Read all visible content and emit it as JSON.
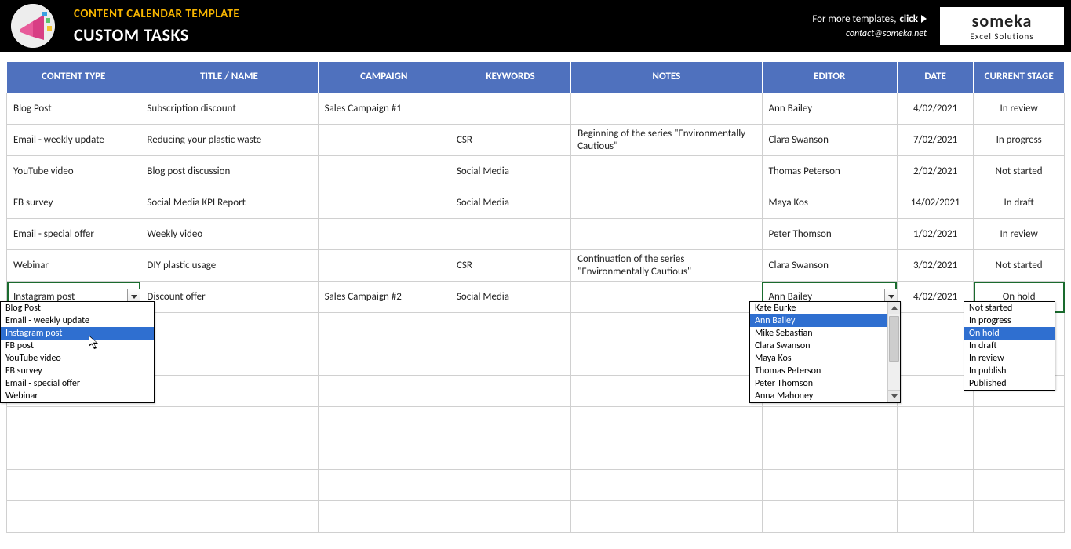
{
  "header": {
    "brand": "CONTENT CALENDAR TEMPLATE",
    "title": "CUSTOM TASKS",
    "more_text": "For more templates, ",
    "more_bold": "click",
    "contact": "contact@someka.net",
    "logo_big": "someka",
    "logo_small": "Excel Solutions"
  },
  "columns": [
    "CONTENT TYPE",
    "TITLE / NAME",
    "CAMPAIGN",
    "KEYWORDS",
    "NOTES",
    "EDITOR",
    "DATE",
    "CURRENT STAGE"
  ],
  "rows": [
    {
      "type": "Blog Post",
      "title": "Subscription discount",
      "campaign": "Sales Campaign #1",
      "keywords": "",
      "notes": "",
      "editor": "Ann Bailey",
      "date": "4/02/2021",
      "stage": "In review"
    },
    {
      "type": "Email - weekly update",
      "title": "Reducing your plastic waste",
      "campaign": "",
      "keywords": "CSR",
      "notes": "Beginning of the series \"Environmentally Cautious\"",
      "editor": "Clara Swanson",
      "date": "7/02/2021",
      "stage": "In progress"
    },
    {
      "type": "YouTube video",
      "title": "Blog post discussion",
      "campaign": "",
      "keywords": "Social Media",
      "notes": "",
      "editor": "Thomas Peterson",
      "date": "2/02/2021",
      "stage": "Not started"
    },
    {
      "type": "FB survey",
      "title": "Social Media KPI Report",
      "campaign": "",
      "keywords": "Social Media",
      "notes": "",
      "editor": "Maya Kos",
      "date": "14/02/2021",
      "stage": "In draft"
    },
    {
      "type": "Email - special offer",
      "title": "Weekly video",
      "campaign": "",
      "keywords": "",
      "notes": "",
      "editor": "Peter Thomson",
      "date": "1/02/2021",
      "stage": "In review"
    },
    {
      "type": "Webinar",
      "title": "DIY plastic usage",
      "campaign": "",
      "keywords": "CSR",
      "notes": "Continuation of the series \"Environmentally Cautious\"",
      "editor": "Clara Swanson",
      "date": "3/02/2021",
      "stage": "Not started"
    },
    {
      "type": "Instagram post",
      "title": "Discount offer",
      "campaign": "Sales Campaign #2",
      "keywords": "Social Media",
      "notes": "",
      "editor": "Ann Bailey",
      "date": "4/02/2021",
      "stage": "On hold"
    }
  ],
  "dropdowns": {
    "content_type": {
      "options": [
        "Blog Post",
        "Email - weekly update",
        "Instagram post",
        "FB post",
        "YouTube video",
        "FB survey",
        "Email - special offer",
        "Webinar"
      ],
      "selected": "Instagram post"
    },
    "editor": {
      "options": [
        "Kate Burke",
        "Ann Bailey",
        "Mike Sebastian",
        "Clara Swanson",
        "Maya Kos",
        "Thomas Peterson",
        "Peter Thomson",
        "Anna Mahoney"
      ],
      "selected": "Ann Bailey"
    },
    "stage": {
      "options": [
        "Not started",
        "In progress",
        "On hold",
        "In draft",
        "In review",
        "In publish",
        "Published"
      ],
      "selected": "On hold"
    }
  }
}
